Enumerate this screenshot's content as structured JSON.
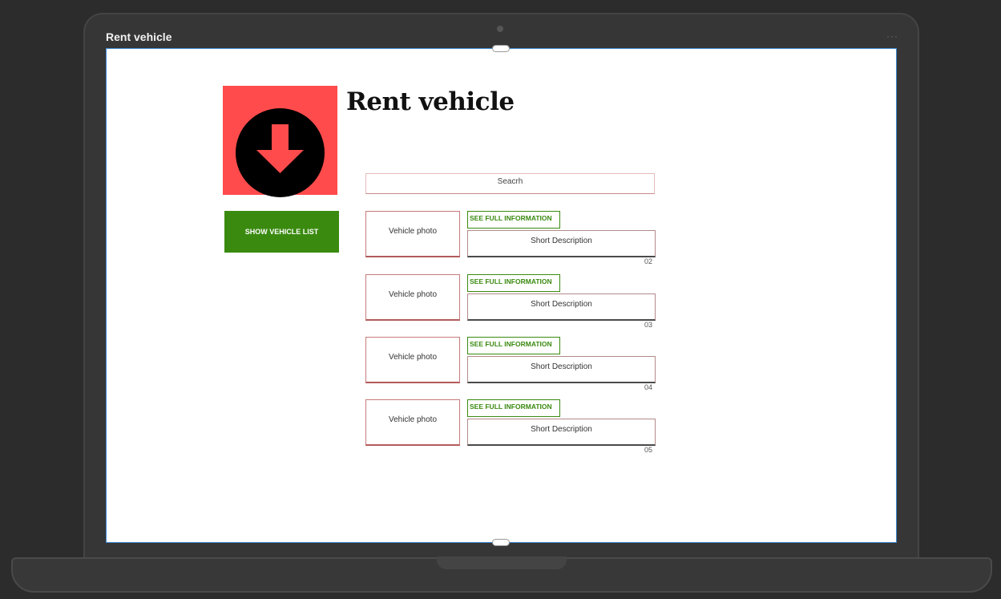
{
  "window": {
    "title": "Rent vehicle",
    "menu_dots": "···"
  },
  "page": {
    "title": "Rent vehicle",
    "logo_icon": "arrow-down-circle-icon",
    "colors": {
      "logo_bg": "#ff4b4b",
      "accent_green": "#3a8a10",
      "screen_border": "#3d8bd6"
    }
  },
  "sidebar": {
    "show_list_label": "SHOW VEHICLE LIST"
  },
  "search": {
    "placeholder": "Seacrh"
  },
  "vehicles": [
    {
      "photo_label": "Vehicle photo",
      "info_label": "SEE FULL INFORMATION",
      "description": "Short Description",
      "number": "02"
    },
    {
      "photo_label": "Vehicle photo",
      "info_label": "SEE FULL INFORMATION",
      "description": "Short Description",
      "number": "03"
    },
    {
      "photo_label": "Vehicle photo",
      "info_label": "SEE FULL INFORMATION",
      "description": "Short Description",
      "number": "04"
    },
    {
      "photo_label": "Vehicle photo",
      "info_label": "SEE FULL INFORMATION",
      "description": "Short Description",
      "number": "05"
    }
  ]
}
